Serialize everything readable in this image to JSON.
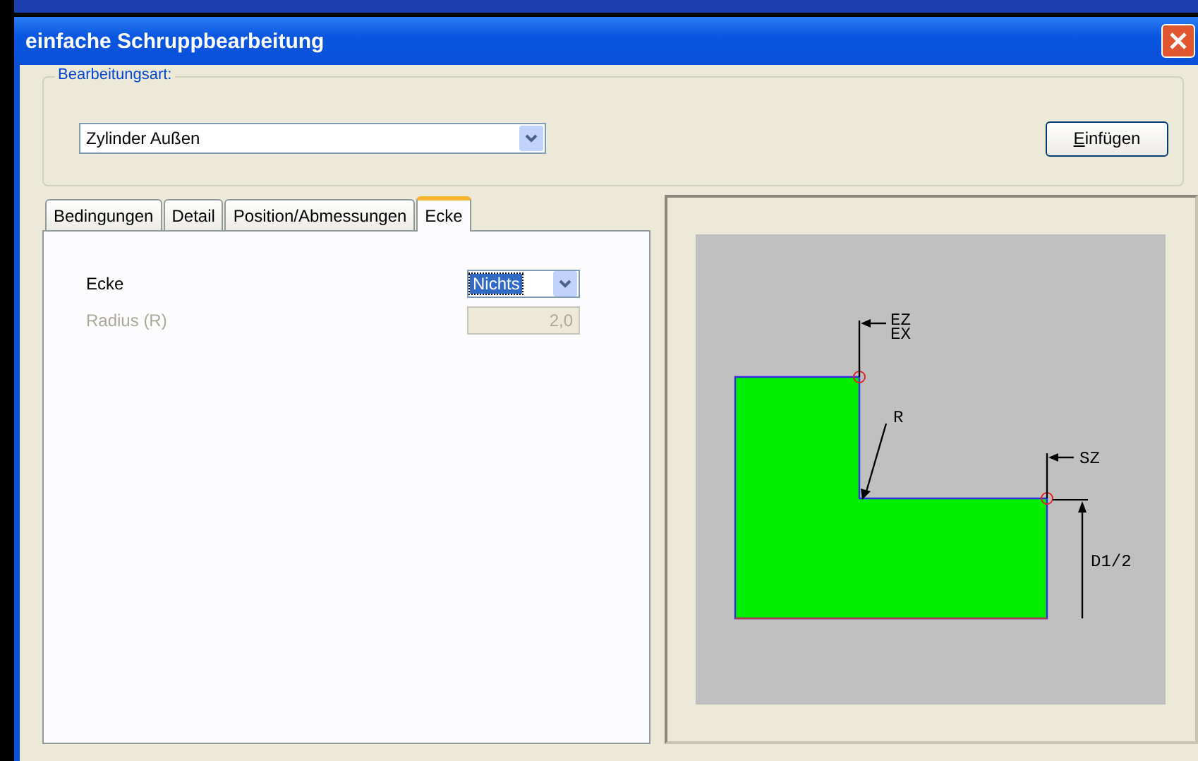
{
  "window": {
    "title": "einfache Schruppbearbeitung"
  },
  "machining_type": {
    "label": "Bearbeitungsart:",
    "value": "Zylinder Außen"
  },
  "insert_button": {
    "label": "Einfügen"
  },
  "tabs": [
    {
      "label": "Bedingungen",
      "selected": false
    },
    {
      "label": "Detail",
      "selected": false
    },
    {
      "label": "Position/Abmessungen",
      "selected": false
    },
    {
      "label": "Ecke",
      "selected": true
    }
  ],
  "fields": [
    {
      "kind": "select",
      "label": "Ecke",
      "value": "Nichts",
      "disabled": false
    },
    {
      "kind": "number",
      "label": "Radius (R)",
      "value": "2,0",
      "disabled": true
    }
  ],
  "diagram": {
    "end_labels": [
      "EZ",
      "EX"
    ],
    "radius_label": "R",
    "start_label": "SZ",
    "diameter_label": "D1/2"
  }
}
